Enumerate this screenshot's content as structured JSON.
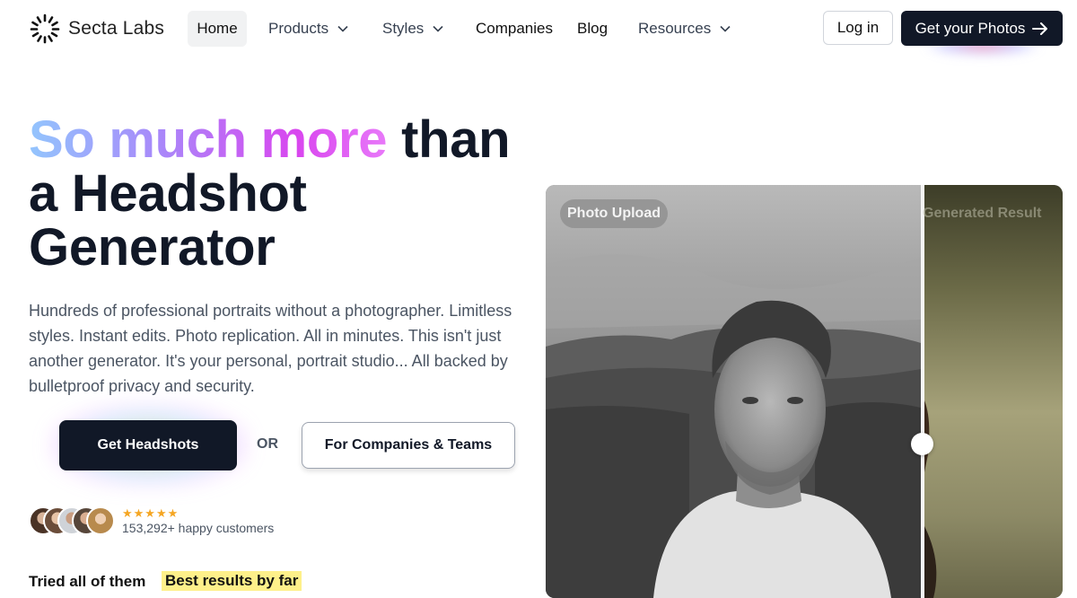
{
  "brand": {
    "name": "Secta Labs",
    "logo_icon": "sunburst-logo-icon"
  },
  "nav": {
    "home": "Home",
    "products": "Products",
    "styles": "Styles",
    "companies": "Companies",
    "blog": "Blog",
    "resources": "Resources",
    "login": "Log in",
    "cta": "Get your Photos",
    "cta_icon": "arrow-right-icon",
    "dropdown_icon": "chevron-down-icon"
  },
  "hero": {
    "headline_gradient": "So much more",
    "headline_rest_1": " than",
    "headline_rest_2": "a Headshot",
    "headline_rest_3": "Generator",
    "gradient_colors": [
      "#93c5fd",
      "#a78bfa",
      "#d946ef"
    ],
    "subtext": "Hundreds of professional portraits without a photographer. Limitless styles. Instant edits. Photo replication. All in minutes. This isn't just another generator. It's your personal, portrait studio... All backed by bulletproof privacy and security.",
    "primary_button": "Get Headshots",
    "or_label": "OR",
    "secondary_button": "For Companies & Teams",
    "rating": "★★★★★",
    "customers": "153,292+ happy customers",
    "tried": "Tried all of them",
    "best": "Best results by far"
  },
  "comparison": {
    "left_label": "Photo Upload",
    "right_label": "Generated Result",
    "slider_icon": "slider-handle-icon"
  },
  "colors": {
    "dark": "#111827",
    "text_muted": "#4b5563",
    "highlight": "#fef08a",
    "star": "#f5a623"
  }
}
